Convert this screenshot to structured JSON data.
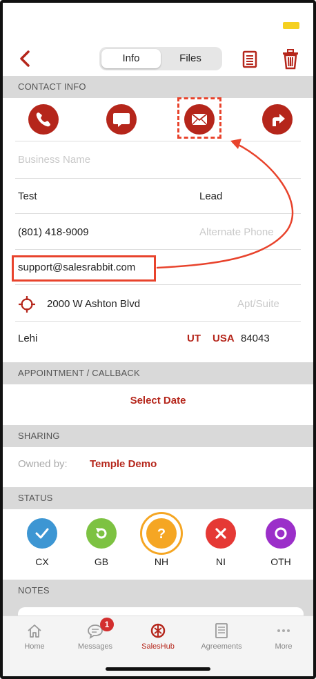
{
  "nav": {
    "tab_info": "Info",
    "tab_files": "Files"
  },
  "contact_info": {
    "header": "CONTACT INFO",
    "business_name_placeholder": "Business Name",
    "first_name": "Test",
    "last_name": "Lead",
    "phone": "(801) 418-9009",
    "alt_phone_placeholder": "Alternate Phone",
    "email": "support@salesrabbit.com",
    "address": "2000 W Ashton Blvd",
    "apt_placeholder": "Apt/Suite",
    "city": "Lehi",
    "state": "UT",
    "country": "USA",
    "zip": "84043"
  },
  "appointment": {
    "header": "APPOINTMENT / CALLBACK",
    "select_date": "Select Date"
  },
  "sharing": {
    "header": "SHARING",
    "owned_by_label": "Owned by:",
    "owner": "Temple Demo"
  },
  "status": {
    "header": "STATUS",
    "items": [
      {
        "code": "CX",
        "color": "#3d96d3",
        "icon": "check-icon"
      },
      {
        "code": "GB",
        "color": "#7dc242",
        "icon": "refresh-icon"
      },
      {
        "code": "NH",
        "color": "#f5a623",
        "icon": "question-icon",
        "selected": true
      },
      {
        "code": "NI",
        "color": "#e53935",
        "icon": "x-icon"
      },
      {
        "code": "OTH",
        "color": "#9b2fc9",
        "icon": "circle-icon"
      }
    ]
  },
  "notes": {
    "header": "NOTES"
  },
  "tabbar": {
    "items": [
      {
        "label": "Home",
        "icon": "home-icon"
      },
      {
        "label": "Messages",
        "icon": "messages-icon",
        "badge": "1"
      },
      {
        "label": "SalesHub",
        "icon": "saleshub-icon",
        "active": true
      },
      {
        "label": "Agreements",
        "icon": "agreements-icon"
      },
      {
        "label": "More",
        "icon": "more-icon"
      }
    ]
  },
  "colors": {
    "accent": "#b5261b",
    "annotation": "#e8432c",
    "section_bg": "#d9d9d9"
  }
}
